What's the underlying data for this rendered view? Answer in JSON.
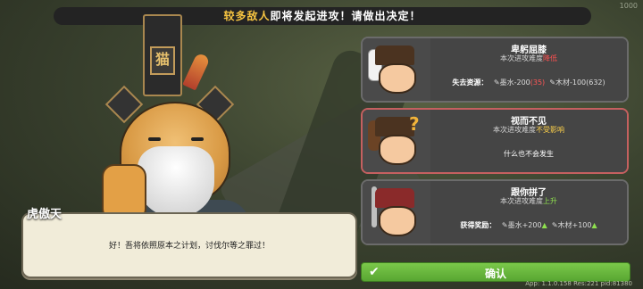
{
  "header": {
    "highlight": "较多敌人",
    "rest": "即将发起进攻！请做出决定！",
    "version": "1000"
  },
  "character": {
    "hat_text": "猫",
    "name": "虎傲天",
    "dialogue": "好！吾将依照原本之计划，讨伐尔等之罪过！"
  },
  "options": [
    {
      "title": "卑躬屈膝",
      "sub_prefix": "本次进攻难度",
      "sub_value": "降低",
      "detail_label": "失去资源：",
      "detail_ink": "墨水-200",
      "detail_ink_paren": "(35)",
      "detail_wood": "木材-100",
      "detail_wood_paren": "(632)",
      "avatar_icon": "white-flag-icon"
    },
    {
      "title": "视而不见",
      "sub_prefix": "本次进攻难度",
      "sub_value": "不受影响",
      "detail": "什么也不会发生",
      "avatar_icon": "club-icon"
    },
    {
      "title": "跟你拼了",
      "sub_prefix": "本次进攻难度",
      "sub_value": "上升",
      "detail_label": "获得奖励：",
      "detail_ink": "墨水+200",
      "detail_wood": "木材+100",
      "avatar_icon": "sword-icon"
    }
  ],
  "confirm": {
    "label": "确认",
    "icon": "check-icon"
  },
  "footer": {
    "info": "App: 1.1.0.158 Res:221 pid:81380"
  },
  "colors": {
    "accent": "#f6c441",
    "confirm": "#6ab93d",
    "selected_border": "#c56060"
  }
}
